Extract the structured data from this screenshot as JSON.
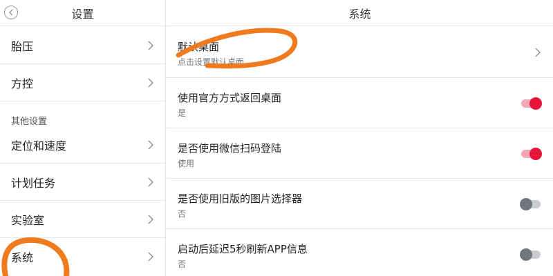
{
  "left": {
    "title": "设置",
    "items": [
      {
        "label": "胎压"
      },
      {
        "label": "方控"
      },
      {
        "label": "定位和速度"
      },
      {
        "label": "计划任务"
      },
      {
        "label": "实验室"
      },
      {
        "label": "系统"
      }
    ],
    "section_label": "其他设置"
  },
  "right": {
    "title": "系统",
    "rows": [
      {
        "title": "默认桌面",
        "subtitle": "点击设置默认桌面",
        "control": "chevron"
      },
      {
        "title": "使用官方方式返回桌面",
        "subtitle": "是",
        "control": "toggle",
        "on": true
      },
      {
        "title": "是否使用微信扫码登陆",
        "subtitle": "使用",
        "control": "toggle",
        "on": true
      },
      {
        "title": "是否使用旧版的图片选择器",
        "subtitle": "否",
        "control": "toggle",
        "on": false
      },
      {
        "title": "启动后延迟5秒刷新APP信息",
        "subtitle": "否",
        "control": "toggle",
        "on": false
      }
    ]
  },
  "colors": {
    "toggle_on_knob": "#e8153a",
    "toggle_on_track": "#f1a7b4",
    "toggle_off_knob": "#707780",
    "toggle_off_track": "#c9cdd2",
    "annotation": "#f07a1e"
  }
}
